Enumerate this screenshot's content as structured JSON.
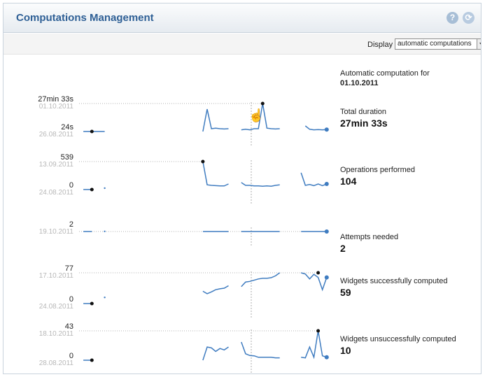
{
  "header": {
    "title": "Computations Management",
    "help_icon": "?",
    "refresh_icon": "refresh-icon"
  },
  "toolbar": {
    "display_label": "Display",
    "display_value": "automatic computations"
  },
  "info": {
    "caption": "Automatic computation for",
    "date": "01.10.2011"
  },
  "colors": {
    "line": "#3f7cc0",
    "marker": "#111111",
    "guide": "#9a9a9a"
  },
  "chart_data": [
    {
      "type": "line",
      "name": "Total duration",
      "value": "27min 33s",
      "max_label": "27min 33s",
      "max_date": "01.10.2011",
      "min_label": "24s",
      "min_date": "26.08.2011",
      "series": [
        [
          [
            1,
            0.0
          ],
          [
            6,
            0.0
          ]
        ],
        [
          [
            29,
            0.0
          ],
          [
            30,
            0.8
          ],
          [
            31,
            0.1
          ],
          [
            32,
            0.12
          ],
          [
            33,
            0.1
          ],
          [
            34,
            0.09
          ],
          [
            35,
            0.1
          ]
        ],
        [
          [
            38,
            0.06
          ],
          [
            39,
            0.08
          ],
          [
            40,
            0.06
          ],
          [
            41,
            0.1
          ],
          [
            42,
            0.1
          ],
          [
            43,
            1.0
          ],
          [
            44,
            0.12
          ],
          [
            45,
            0.1
          ],
          [
            46,
            0.09
          ],
          [
            47,
            0.1
          ]
        ],
        [
          [
            53,
            0.2
          ],
          [
            54,
            0.08
          ],
          [
            55,
            0.06
          ],
          [
            56,
            0.07
          ],
          [
            57,
            0.06
          ],
          [
            58,
            0.07
          ]
        ]
      ],
      "marker_min": [
        3,
        0.0
      ],
      "marker_max": [
        43,
        1.0
      ],
      "current": [
        58,
        0.07
      ]
    },
    {
      "type": "line",
      "name": "Operations performed",
      "value": "104",
      "max_label": "539",
      "max_date": "13.09.2011",
      "min_label": "0",
      "min_date": "24.08.2011",
      "series": [
        [
          [
            1,
            0.0
          ],
          [
            3,
            0.0
          ]
        ],
        [
          [
            6,
            0.05
          ],
          [
            6,
            0.05
          ]
        ],
        [
          [
            29,
            1.0
          ],
          [
            30,
            0.17
          ],
          [
            31,
            0.15
          ],
          [
            32,
            0.14
          ],
          [
            33,
            0.13
          ],
          [
            34,
            0.13
          ],
          [
            35,
            0.2
          ]
        ],
        [
          [
            38,
            0.25
          ],
          [
            39,
            0.15
          ],
          [
            40,
            0.15
          ],
          [
            41,
            0.13
          ],
          [
            42,
            0.13
          ],
          [
            43,
            0.12
          ],
          [
            44,
            0.13
          ],
          [
            45,
            0.12
          ],
          [
            46,
            0.15
          ],
          [
            47,
            0.17
          ]
        ],
        [
          [
            52,
            0.6
          ],
          [
            53,
            0.15
          ],
          [
            54,
            0.18
          ],
          [
            55,
            0.14
          ],
          [
            56,
            0.2
          ],
          [
            57,
            0.14
          ],
          [
            58,
            0.2
          ]
        ]
      ],
      "marker_min": [
        3,
        0.0
      ],
      "marker_max": [
        29,
        1.0
      ],
      "current": [
        58,
        0.2
      ]
    },
    {
      "type": "line",
      "name": "Attempts needed",
      "value": "2",
      "max_label": "2",
      "max_date": "19.10.2011",
      "min_label": "",
      "min_date": "",
      "series": [
        [
          [
            1,
            0.0
          ],
          [
            3,
            0.0
          ]
        ],
        [
          [
            6,
            0.05
          ],
          [
            6,
            0.05
          ]
        ],
        [
          [
            29,
            0.0
          ],
          [
            35,
            0.0
          ]
        ],
        [
          [
            38,
            0.0
          ],
          [
            47,
            0.0
          ]
        ],
        [
          [
            52,
            0.0
          ],
          [
            58,
            0.0
          ]
        ]
      ],
      "marker_min": null,
      "marker_max": null,
      "current": [
        58,
        0.0
      ]
    },
    {
      "type": "line",
      "name": "Widgets successfully computed",
      "value": "59",
      "max_label": "77",
      "max_date": "17.10.2011",
      "min_label": "0",
      "min_date": "24.08.2011",
      "series": [
        [
          [
            1,
            0.0
          ],
          [
            3,
            0.0
          ]
        ],
        [
          [
            6,
            0.2
          ],
          [
            6,
            0.2
          ]
        ],
        [
          [
            29,
            0.4
          ],
          [
            30,
            0.32
          ],
          [
            31,
            0.38
          ],
          [
            32,
            0.45
          ],
          [
            33,
            0.48
          ],
          [
            34,
            0.5
          ],
          [
            35,
            0.58
          ]
        ],
        [
          [
            38,
            0.55
          ],
          [
            39,
            0.7
          ],
          [
            40,
            0.72
          ],
          [
            41,
            0.76
          ],
          [
            42,
            0.8
          ],
          [
            43,
            0.82
          ],
          [
            44,
            0.82
          ],
          [
            45,
            0.84
          ],
          [
            46,
            0.9
          ],
          [
            47,
            1.0
          ]
        ],
        [
          [
            52,
            1.0
          ],
          [
            53,
            0.96
          ],
          [
            54,
            0.8
          ],
          [
            55,
            0.95
          ],
          [
            56,
            0.85
          ],
          [
            57,
            0.45
          ],
          [
            58,
            0.85
          ]
        ]
      ],
      "marker_min": [
        3,
        0.0
      ],
      "marker_max": [
        56,
        1.0
      ],
      "current": [
        58,
        0.85
      ]
    },
    {
      "type": "line",
      "name": "Widgets unsuccessfully computed",
      "value": "10",
      "max_label": "43",
      "max_date": "18.10.2011",
      "min_label": "0",
      "min_date": "28.08.2011",
      "series": [
        [
          [
            1,
            0.0
          ],
          [
            3,
            0.0
          ]
        ],
        [
          [
            29,
            0.0
          ],
          [
            30,
            0.45
          ],
          [
            31,
            0.42
          ],
          [
            32,
            0.3
          ],
          [
            33,
            0.4
          ],
          [
            34,
            0.35
          ],
          [
            35,
            0.45
          ]
        ],
        [
          [
            38,
            0.62
          ],
          [
            39,
            0.22
          ],
          [
            40,
            0.16
          ],
          [
            41,
            0.15
          ],
          [
            42,
            0.1
          ],
          [
            43,
            0.1
          ],
          [
            44,
            0.1
          ],
          [
            45,
            0.1
          ],
          [
            46,
            0.08
          ],
          [
            47,
            0.08
          ]
        ],
        [
          [
            52,
            0.1
          ],
          [
            53,
            0.08
          ],
          [
            54,
            0.45
          ],
          [
            55,
            0.1
          ],
          [
            56,
            1.0
          ],
          [
            57,
            0.15
          ],
          [
            58,
            0.1
          ]
        ]
      ],
      "marker_min": [
        3,
        0.0
      ],
      "marker_max": [
        56,
        1.0
      ],
      "current": [
        58,
        0.1
      ]
    }
  ]
}
